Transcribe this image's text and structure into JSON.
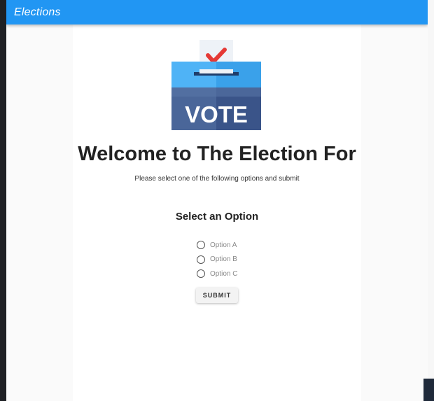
{
  "appbar": {
    "title": "Elections"
  },
  "logo": {
    "icon": "ballot-box-vote-icon",
    "text": "VOTE"
  },
  "main": {
    "headline": "Welcome to The Election For",
    "subtitle": "Please select one of the following options and submit",
    "section_heading": "Select an Option"
  },
  "options": [
    {
      "label": "Option A",
      "selected": false
    },
    {
      "label": "Option B",
      "selected": false
    },
    {
      "label": "Option C",
      "selected": false
    }
  ],
  "submit_label": "SUBMIT",
  "colors": {
    "appbar": "#2196f3",
    "ballot_top": "#4fb3f6",
    "ballot_bottom": "#3d5a8c",
    "checkmark": "#e53935"
  }
}
